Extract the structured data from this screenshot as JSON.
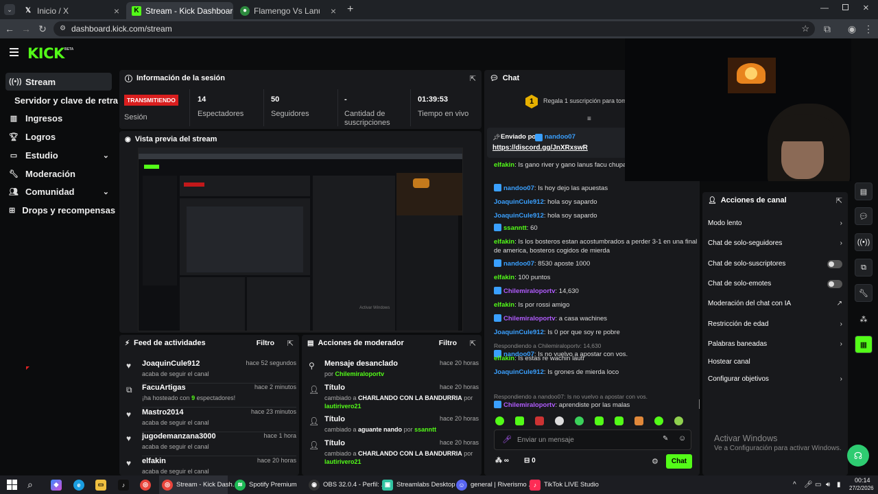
{
  "browser": {
    "tabs": [
      {
        "title": "Inicio / X"
      },
      {
        "title": "Stream - Kick Dashboard"
      },
      {
        "title": "Flamengo Vs Lanús - Resultado"
      }
    ],
    "new_tab": "+",
    "url": "dashboard.kick.com/stream"
  },
  "app": {
    "logo": "KICK",
    "logo_beta": "BETA"
  },
  "sidebar": {
    "items": [
      {
        "label": "Stream",
        "icon": "broadcast-icon"
      },
      {
        "label": "Servidor y clave de retransmisión"
      },
      {
        "label": "Ingresos",
        "icon": "chart-icon"
      },
      {
        "label": "Logros",
        "icon": "trophy-icon"
      },
      {
        "label": "Estudio",
        "icon": "monitor-icon"
      },
      {
        "label": "Moderación",
        "icon": "wrench-icon"
      },
      {
        "label": "Comunidad",
        "icon": "people-icon"
      },
      {
        "label": "Drops y recompensas",
        "icon": "gift-icon"
      }
    ]
  },
  "session": {
    "title": "Información de la sesión",
    "live_badge": "TRANSMITIENDO",
    "session_label": "Sesión",
    "stats": [
      {
        "value": "14",
        "label": "Espectadores"
      },
      {
        "value": "50",
        "label": "Seguidores"
      },
      {
        "value": "-",
        "label": "Cantidad de suscripciones"
      },
      {
        "value": "01:39:53",
        "label": "Tiempo en vivo"
      }
    ]
  },
  "preview": {
    "title": "Vista previa del stream"
  },
  "feed": {
    "title": "Feed de actividades",
    "filter": "Filtro",
    "items": [
      {
        "name": "JoaquinCule912",
        "sub": "acaba de seguir el canal",
        "time": "hace 52 segundos",
        "icon": "heart-icon"
      },
      {
        "name": "FacuArtigas",
        "sub_pre": "¡ha hosteado con ",
        "sub_num": "9",
        "sub_post": " espectadores!",
        "time": "hace 2 minutos",
        "icon": "host-icon"
      },
      {
        "name": "Mastro2014",
        "sub": "acaba de seguir el canal",
        "time": "hace 23 minutos",
        "icon": "heart-icon"
      },
      {
        "name": "jugodemanzana3000",
        "sub": "acaba de seguir el canal",
        "time": "hace 1 hora",
        "icon": "heart-icon"
      },
      {
        "name": "elfakin",
        "sub": "acaba de seguir el canal",
        "time": "hace 20 horas",
        "icon": "heart-icon"
      }
    ]
  },
  "modactions": {
    "title": "Acciones de moderador",
    "filter": "Filtro",
    "items": [
      {
        "name": "Mensaje desanclado",
        "l1": "por",
        "l1v": "Chilemiraloportv",
        "time": "hace 20 horas"
      },
      {
        "name": "Título",
        "l1": "cambiado a",
        "l1v": "CHARLANDO CON LA BANDURRIA",
        "l2": "por",
        "l2v": "lautirivero21",
        "time": "hace 20 horas"
      },
      {
        "name": "Título",
        "l1": "cambiado a",
        "l1v": "aguante nando",
        "l2": "por",
        "l2v": "ssanntt",
        "time": "hace 20 horas"
      },
      {
        "name": "Título",
        "l1": "cambiado a",
        "l1v": "CHARLANDO CON LA BANDURRIA",
        "l2": "por",
        "l2v": "lautirivero21",
        "time": "hace 20 horas"
      }
    ]
  },
  "chat": {
    "title": "Chat",
    "gift_text": "Regala 1 suscripción para toma",
    "gift_num": "1",
    "pinned_label": "Enviado por",
    "pinned_user": "nandoo07",
    "pinned_link": "https://discord.gg/JnXRxswR",
    "messages": [
      {
        "user": "elfakin",
        "color": "g",
        "text": "Is gano river y gano lanus facu chupala lautirivero21"
      },
      {
        "user": "nandoo07",
        "color": "b",
        "badge": true,
        "text": "Is hoy dejo las apuestas"
      },
      {
        "user": "JoaquinCule912",
        "color": "b",
        "text": "hola soy sapardo"
      },
      {
        "user": "JoaquinCule912",
        "color": "b",
        "text": "hola soy sapardo"
      },
      {
        "user": "ssanntt",
        "color": "g",
        "badge": true,
        "text": "60"
      },
      {
        "user": "elfakin",
        "color": "g",
        "text": "Is los bosteros estan acostumbrados a perder 3-1 en una final de america, bosteros cogidos de mierda"
      },
      {
        "user": "nandoo07",
        "color": "b",
        "badge": true,
        "text": "8530 aposte 1000"
      },
      {
        "user": "elfakin",
        "color": "g",
        "text": "100 puntos"
      },
      {
        "user": "Chilemiraloportv",
        "color": "p",
        "badge": true,
        "text": "14,630"
      },
      {
        "user": "elfakin",
        "color": "g",
        "text": "Is por rossi amigo"
      },
      {
        "user": "Chilemiraloportv",
        "color": "p",
        "badge": true,
        "text": "a casa wachines"
      },
      {
        "user": "JoaquinCule912",
        "color": "b",
        "text": "Is 0 por que soy re pobre"
      },
      {
        "user": "nandoo07",
        "color": "b",
        "badge": true,
        "reply": "Respondiendo a Chilemiraloportv: 14,630",
        "text": "Is no vuelvo a apostar con vos."
      },
      {
        "user": "elfakin",
        "color": "g",
        "text": "Is estas re wachin lauti"
      },
      {
        "user": "JoaquinCule912",
        "color": "b",
        "text": "Is grones de mierda loco"
      },
      {
        "user": "Chilemiraloportv",
        "color": "p",
        "badge": true,
        "reply": "Respondiendo a nandoo07: Is no vuelvo a apostar con vos.",
        "text": "aprendiste por las malas"
      }
    ],
    "input_placeholder": "Enviar un mensaje",
    "points": "∞",
    "gift_count": "0",
    "send": "Chat"
  },
  "channel_actions": {
    "title": "Acciones de canal",
    "items": [
      {
        "label": "Modo lento",
        "control": "chevron"
      },
      {
        "label": "Chat de solo-seguidores",
        "control": "chevron"
      },
      {
        "label": "Chat de solo-suscriptores",
        "control": "toggle"
      },
      {
        "label": "Chat de solo-emotes",
        "control": "toggle"
      },
      {
        "label": "Moderación del chat con IA",
        "control": "external"
      },
      {
        "label": "Restricción de edad",
        "control": "chevron"
      },
      {
        "label": "Palabras baneadas",
        "control": "chevron"
      },
      {
        "label": "Hostear canal",
        "control": "none"
      },
      {
        "label": "Configurar objetivos",
        "control": "chevron"
      }
    ]
  },
  "windows": {
    "activate_title": "Activar Windows",
    "activate_sub": "Ve a Configuración para activar Windows."
  },
  "taskbar": {
    "apps": [
      {
        "label": "Stream - Kick Dash..."
      },
      {
        "label": "Spotify Premium"
      },
      {
        "label": "OBS 32.0.4 - Perfil: ..."
      },
      {
        "label": "Streamlabs Desktop"
      },
      {
        "label": "general | Riverismo ..."
      },
      {
        "label": "TikTok LIVE Studio"
      }
    ],
    "time": "00:14",
    "date": "27/2/2026"
  },
  "colors": {
    "accent": "#53fc18",
    "live": "#d91e1e",
    "bg": "#0b0c0d",
    "panel": "#18191c"
  }
}
